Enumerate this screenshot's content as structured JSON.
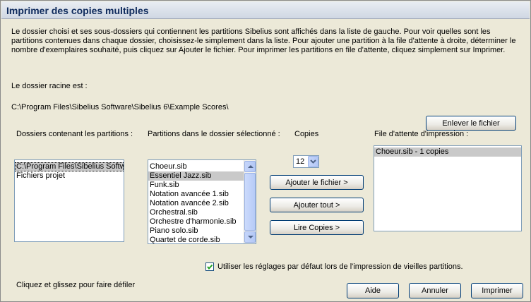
{
  "window": {
    "title": "Imprimer des copies multiples"
  },
  "description": "Le dossier choisi et ses sous-dossiers qui contiennent les partitions Sibelius sont affichés dans la liste de gauche. Pour voir quelles sont les partitions contenues dans chaque dossier, choisissez-le simplement dans la liste. Pour ajouter une partition à la file d'attente à droite, déterminer le nombre d'exemplaires souhaité, puis cliquez sur Ajouter le fichier. Pour imprimer les partitions en file d'attente, cliquez simplement sur Imprimer.",
  "root": {
    "label": "Le dossier racine est :",
    "path": "C:\\Program Files\\Sibelius Software\\Sibelius 6\\Example Scores\\"
  },
  "folders": {
    "label": "Dossiers contenant les partitions :",
    "items": [
      "C:\\Program Files\\Sibelius Softw",
      "Fichiers projet"
    ],
    "selected_index": 0
  },
  "scores": {
    "label": "Partitions dans le dossier sélectionné :",
    "items": [
      "Choeur.sib",
      "Essentiel Jazz.sib",
      "Funk.sib",
      "Notation avancée 1.sib",
      "Notation avancée 2.sib",
      "Orchestral.sib",
      "Orchestre d'harmonie.sib",
      "Piano solo.sib",
      "Quartet de corde.sib"
    ],
    "selected_index": 1
  },
  "copies": {
    "label": "Copies",
    "value": "12"
  },
  "queue": {
    "label": "File d'attente d'impression :",
    "items": [
      "Choeur.sib - 1 copies"
    ],
    "selected_index": 0
  },
  "buttons": {
    "remove": "Enlever le fichier",
    "add_file": "Ajouter le fichier >",
    "add_all": "Ajouter tout >",
    "read_copies": "Lire Copies >",
    "help": "Aide",
    "cancel": "Annuler",
    "print": "Imprimer"
  },
  "default_settings": {
    "label": "Utiliser les réglages par défaut lors de l'impression de vieilles partitions.",
    "checked": true
  },
  "hint": "Cliquez et glissez pour faire défiler",
  "colors": {
    "title_text": "#0e2a5c",
    "button_border": "#003c74",
    "checkbox_check": "#21a121"
  }
}
